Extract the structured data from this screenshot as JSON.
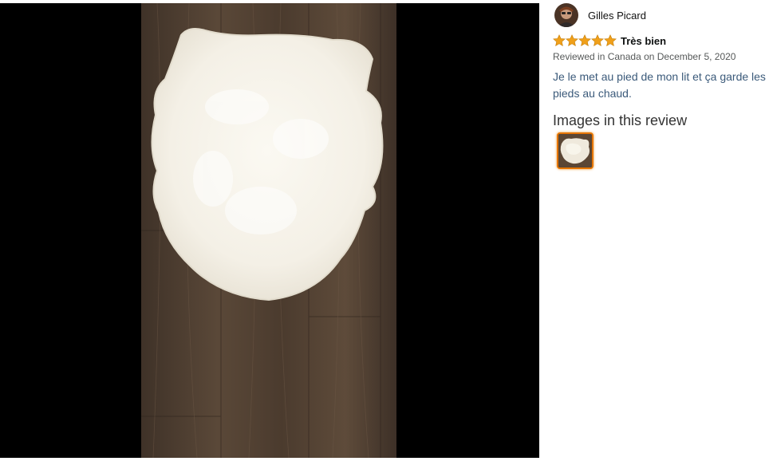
{
  "reviewer": {
    "name": "Gilles Picard",
    "avatar_icon": "avatar-icon"
  },
  "review": {
    "rating": 5,
    "max_rating": 5,
    "title": "Très bien",
    "date_line": "Reviewed in Canada on December 5, 2020",
    "body": "Je le met au pied de mon lit et ça garde les pieds au chaud."
  },
  "images": {
    "heading": "Images in this review",
    "selected_index": 0
  },
  "colors": {
    "star": "#f0a01a",
    "link_text": "#3b5a7a",
    "thumb_border": "#e77600"
  }
}
